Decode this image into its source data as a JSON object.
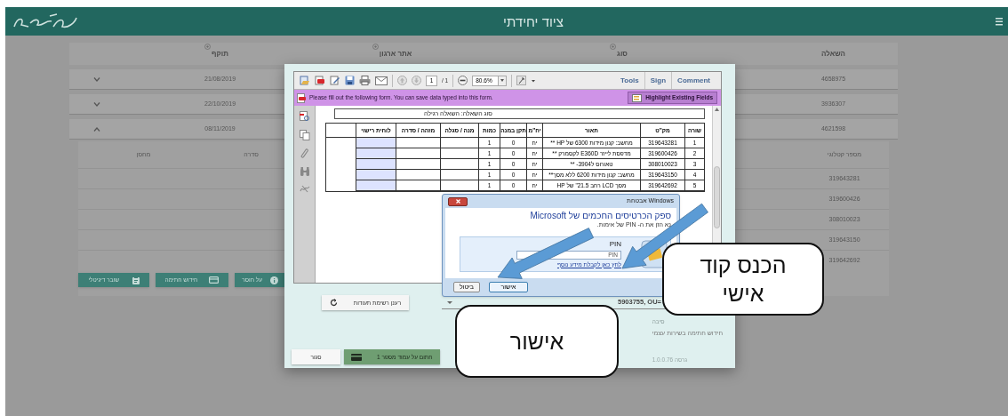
{
  "header": {
    "title": "ציוד יחידתי"
  },
  "loans": {
    "columns": [
      {
        "label": "השאלה",
        "help": false
      },
      {
        "label": "סוג",
        "help": true
      },
      {
        "label": "אתר ארגון",
        "help": true
      },
      {
        "label": "תוקף",
        "help": true
      }
    ],
    "rows": [
      {
        "loan": "4658975",
        "valid_until": "21/08/2019",
        "expanded": false
      },
      {
        "loan": "3936307",
        "valid_until": "22/10/2019",
        "expanded": false
      },
      {
        "loan": "4621598",
        "valid_until": "08/11/2019",
        "expanded": true,
        "details": {
          "columns": [
            "מספר קטלוגי",
            "סדרה",
            "מחסן"
          ],
          "rows": [
            {
              "catalog": "319643281"
            },
            {
              "catalog": "319600426"
            },
            {
              "catalog": "308010023"
            },
            {
              "catalog": "319643150"
            },
            {
              "catalog": "319642692"
            }
          ],
          "actions": [
            {
              "label": "על חוסר",
              "kind": "info"
            },
            {
              "label": "חידוש חתימה",
              "kind": "card"
            },
            {
              "label": "שובר דיגיטלי",
              "kind": "voucher"
            }
          ]
        }
      }
    ]
  },
  "signing_dialog": {
    "viewer": {
      "page": "1",
      "page_count": "/ 1",
      "zoom": "80.6%",
      "tools_link": "Tools",
      "sign_link": "Sign",
      "comment_link": "Comment",
      "notice": "Please fill out the following form. You can save data typed into this form.",
      "highlight_button": "Highlight Existing Fields",
      "form": {
        "type_label": "סוג השאלה:",
        "type_value": "השאלה רגילה",
        "columns": [
          "שורה",
          "מק\"ט",
          "תאור",
          "יח\"מ",
          "תקן במנה",
          "כמות",
          "מנה / סגלה",
          "מזהה / סדרה",
          "לוחית רישוי"
        ],
        "rows": [
          {
            "line": "1",
            "catalog": "319643281",
            "description": "מחשב: קנון מידות 6300 של HP **",
            "unit": "יח",
            "standard": "0",
            "quantity": "1"
          },
          {
            "line": "2",
            "catalog": "319600426",
            "description": "מדפסת לייזר E360D לקסמרק **",
            "unit": "יח",
            "standard": "0",
            "quantity": "1"
          },
          {
            "line": "3",
            "catalog": "308010023",
            "description": "טאורוס ל3904- **",
            "unit": "יח",
            "standard": "0",
            "quantity": "1"
          },
          {
            "line": "4",
            "catalog": "319643150",
            "description": "מחשב: קנון מידות 6200 ללא מסך**",
            "unit": "יח",
            "standard": "0",
            "quantity": "1"
          },
          {
            "line": "5",
            "catalog": "319642692",
            "description": "מסך LCD רחב 21.5\" של HP",
            "unit": "יח",
            "standard": "0",
            "quantity": "1"
          }
        ]
      }
    },
    "refresh_button": "רענן רשימת תעודות",
    "certificate": "5903755, OU=",
    "reason_label": "סיבה",
    "reason": "חידוש חתימה בשירות עצמי",
    "version": "גרסה 1.0.0.76",
    "sign_button": "חתום על עמוד מספר 1",
    "close_button": "סגור"
  },
  "pin_prompt": {
    "title": "אבטחת Windows",
    "heading": "ספק הכרטיסים החכמים של Microsoft",
    "instruction": "נא הזן את ה- PIN של אימות.",
    "pin_label": "PIN",
    "placeholder": "PIN",
    "link": "לחץ כאן לקבלת מידע נוסף",
    "ok_button": "אישור",
    "cancel_button": "ביטול"
  },
  "callouts": [
    {
      "text": "הכנס קוד אישי"
    },
    {
      "text": "אישור"
    }
  ]
}
